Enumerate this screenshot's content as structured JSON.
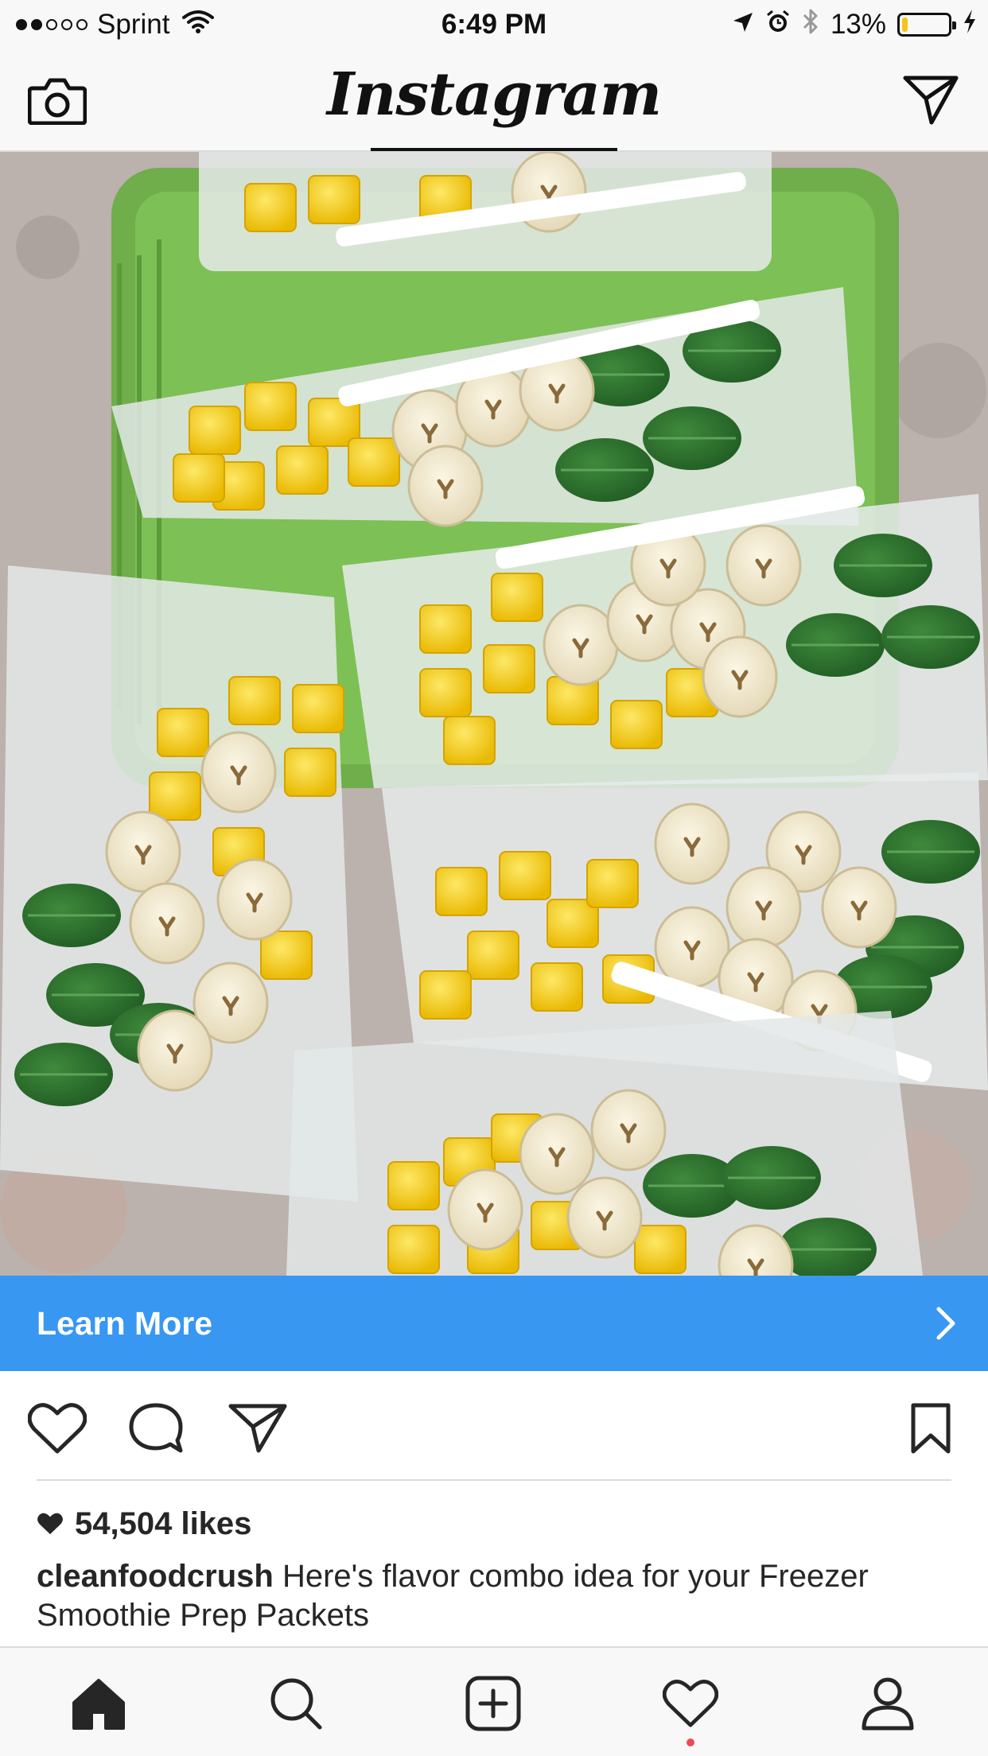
{
  "status_bar": {
    "carrier": "Sprint",
    "time": "6:49 PM",
    "battery_percent": "13%",
    "battery_level": 0.13,
    "signal_bars_filled": 2,
    "signal_bars_total": 5,
    "icons": [
      "wifi-icon",
      "location-arrow-icon",
      "alarm-icon",
      "bluetooth-icon",
      "battery-icon",
      "charging-bolt-icon"
    ]
  },
  "header": {
    "logo_text": "Instagram",
    "left_icon": "camera-icon",
    "right_icon": "direct-message-icon"
  },
  "post": {
    "image_icon": "smoothie-packets-photo",
    "cta_label": "Learn More",
    "cta_color": "#3897f0",
    "likes": "54,504 likes",
    "username": "cleanfoodcrush",
    "caption": "Here's flavor combo idea for your Freezer Smoothie Prep Packets",
    "actions": [
      "like-icon",
      "comment-icon",
      "share-icon",
      "bookmark-icon"
    ]
  },
  "tab_bar": {
    "items": [
      "home-icon",
      "search-icon",
      "new-post-icon",
      "activity-icon",
      "profile-icon"
    ],
    "active": "home-icon",
    "notification_color": "#ed4956"
  }
}
